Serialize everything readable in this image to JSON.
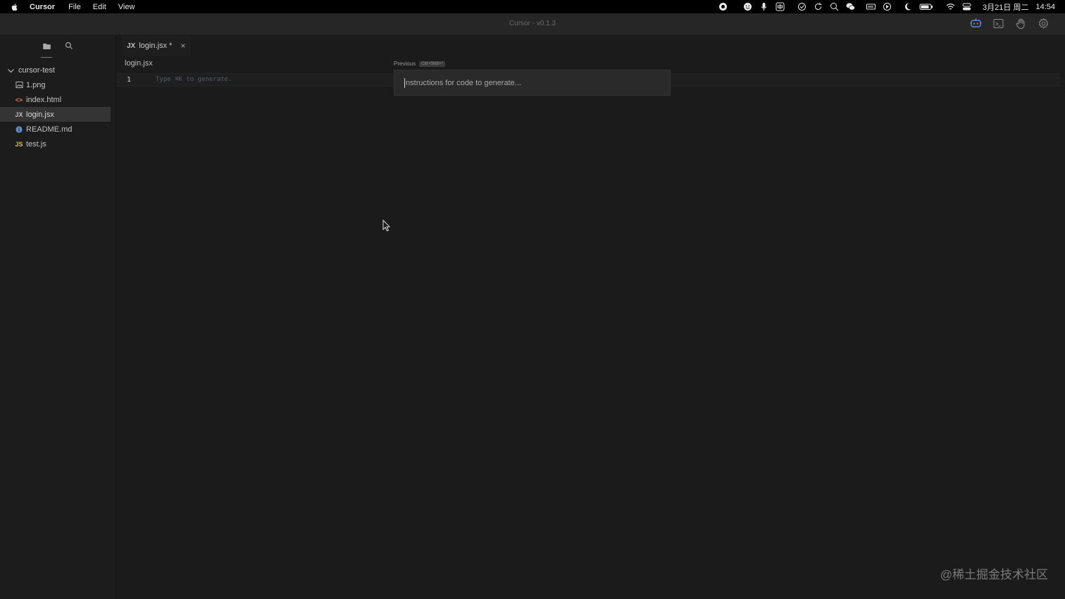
{
  "menubar": {
    "app_name": "Cursor",
    "menus": [
      "File",
      "Edit",
      "View"
    ],
    "date": "3月21日 周二",
    "time": "14:54"
  },
  "window": {
    "title": "Cursor - v0.1.3"
  },
  "sidebar": {
    "root": "cursor-test",
    "items": [
      {
        "label": "1.png",
        "icon": "image-file-icon"
      },
      {
        "label": "index.html",
        "icon": "html-file-icon",
        "icon_text": "<>"
      },
      {
        "label": "login.jsx",
        "icon": "jsx-file-icon",
        "icon_text": "JX",
        "selected": true
      },
      {
        "label": "README.md",
        "icon": "info-file-icon"
      },
      {
        "label": "test.js",
        "icon": "js-file-icon",
        "icon_text": "JS"
      }
    ]
  },
  "editor": {
    "tab": {
      "icon_text": "JX",
      "label": "login.jsx *",
      "close": "×"
    },
    "breadcrumb": "login.jsx",
    "line_number": "1",
    "ghost_text": "Type ⌘K to generate.",
    "generate": {
      "previous_label": "Previous",
      "shortcut": "Ctrl+Shift+^",
      "placeholder": "Instructions for code to generate..."
    }
  },
  "watermark": "@稀土掘金技术社区",
  "colors": {
    "background": "#1b1b1b",
    "sidebar_selected": "#343434",
    "accent_icon": "#5b8dd9",
    "html_icon": "#d5824f",
    "info_icon": "#5e8fc9",
    "js_icon": "#d9c24a"
  }
}
